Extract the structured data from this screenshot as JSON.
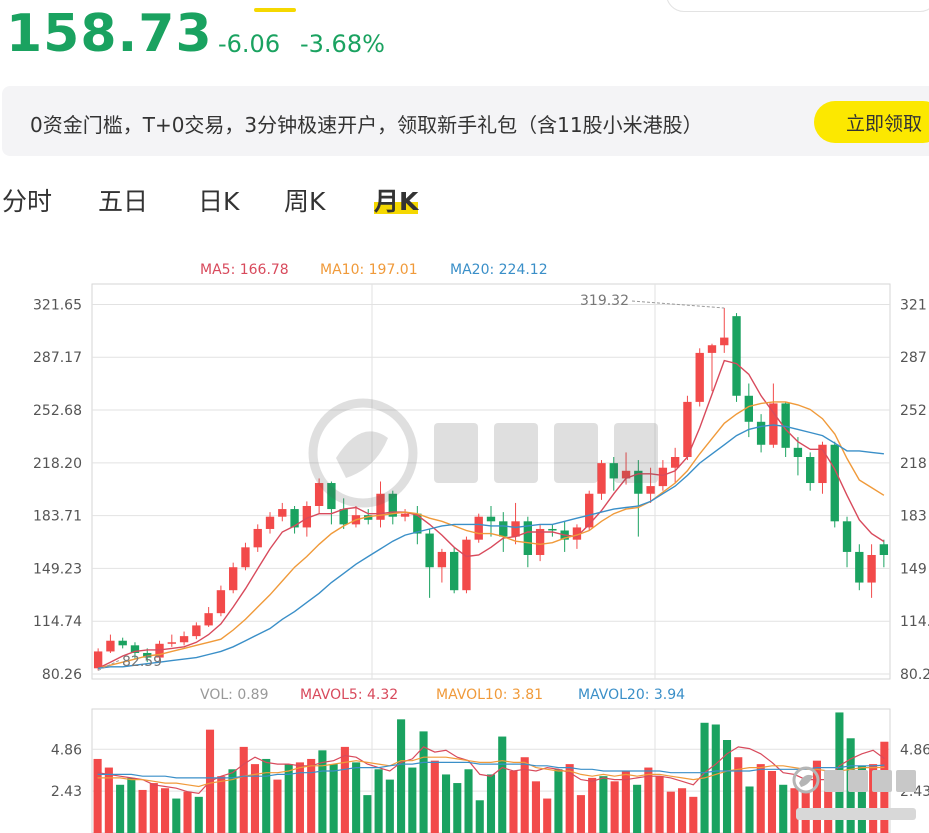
{
  "topnav": {
    "items": [],
    "search_placeholder": ""
  },
  "quote": {
    "price": "158.73",
    "change": "-6.06",
    "change_pct": "-3.68%"
  },
  "banner": {
    "text": "0资金门槛，T+0交易，3分钟极速开户，领取新手礼包（含11股小米港股）",
    "button": "立即领取"
  },
  "tabs": [
    {
      "label": "分时",
      "active": false
    },
    {
      "label": "五日",
      "active": false
    },
    {
      "label": "日K",
      "active": false
    },
    {
      "label": "周K",
      "active": false
    },
    {
      "label": "月K",
      "active": true
    }
  ],
  "chart_data": [
    {
      "type": "candlestick",
      "ylim": [
        77,
        335
      ],
      "y_ticks": [
        "321.65",
        "287.17",
        "252.68",
        "218.20",
        "183.71",
        "149.23",
        "114.74",
        "80.26"
      ],
      "y_ticks_right": [
        "321",
        "287",
        "252",
        "218",
        "183",
        "149",
        "114.",
        "80.2"
      ],
      "y_tick_values": [
        321.65,
        287.17,
        252.68,
        218.2,
        183.71,
        149.23,
        114.74,
        80.26
      ],
      "legend": [
        {
          "label": "MA5: 166.78",
          "color": "#d84a5c"
        },
        {
          "label": "MA10: 197.01",
          "color": "#f09a3a"
        },
        {
          "label": "MA20: 224.12",
          "color": "#3a8fc8"
        }
      ],
      "annotations": {
        "high": "319.32",
        "low": "82.59"
      },
      "colors": {
        "up": "#f24a4a",
        "down": "#1aa260",
        "ma5": "#d84a5c",
        "ma10": "#f09a3a",
        "ma20": "#3a8fc8"
      },
      "candles": [
        [
          84,
          95,
          82.59,
          97
        ],
        [
          95,
          102,
          94,
          106
        ],
        [
          102,
          99,
          97,
          104
        ],
        [
          99,
          94,
          90,
          101
        ],
        [
          94,
          91,
          88,
          97
        ],
        [
          91,
          100,
          89,
          102
        ],
        [
          100,
          101,
          98,
          106
        ],
        [
          101,
          105,
          99,
          108
        ],
        [
          105,
          112,
          103,
          114
        ],
        [
          112,
          120,
          111,
          124
        ],
        [
          120,
          135,
          118,
          138
        ],
        [
          135,
          150,
          133,
          153
        ],
        [
          150,
          163,
          148,
          166
        ],
        [
          163,
          175,
          160,
          178
        ],
        [
          175,
          183,
          172,
          186
        ],
        [
          183,
          188,
          180,
          192
        ],
        [
          188,
          176,
          172,
          190
        ],
        [
          176,
          190,
          170,
          193
        ],
        [
          190,
          205,
          185,
          208
        ],
        [
          205,
          188,
          178,
          206
        ],
        [
          188,
          178,
          175,
          195
        ],
        [
          178,
          184,
          176,
          190
        ],
        [
          184,
          181,
          178,
          188
        ],
        [
          181,
          198,
          176,
          206
        ],
        [
          198,
          183,
          178,
          200
        ],
        [
          183,
          185,
          180,
          188
        ],
        [
          185,
          172,
          165,
          190
        ],
        [
          172,
          150,
          130,
          175
        ],
        [
          150,
          160,
          140,
          162
        ],
        [
          160,
          135,
          133,
          163
        ],
        [
          135,
          168,
          133,
          170
        ],
        [
          168,
          183,
          166,
          185
        ],
        [
          183,
          180,
          170,
          190
        ],
        [
          180,
          170,
          160,
          186
        ],
        [
          170,
          180,
          165,
          192
        ],
        [
          180,
          158,
          150,
          183
        ],
        [
          158,
          175,
          154,
          178
        ],
        [
          175,
          174,
          170,
          178
        ],
        [
          174,
          168,
          160,
          180
        ],
        [
          168,
          176,
          162,
          178
        ],
        [
          176,
          198,
          174,
          200
        ],
        [
          198,
          218,
          194,
          220
        ],
        [
          218,
          208,
          200,
          222
        ],
        [
          208,
          213,
          204,
          225
        ],
        [
          213,
          198,
          170,
          220
        ],
        [
          198,
          203,
          192,
          215
        ],
        [
          203,
          215,
          200,
          220
        ],
        [
          215,
          222,
          205,
          228
        ],
        [
          222,
          258,
          220,
          262
        ],
        [
          258,
          290,
          255,
          293
        ],
        [
          290,
          295,
          265,
          296
        ],
        [
          295,
          300,
          290,
          319.32
        ],
        [
          314,
          262,
          258,
          316
        ],
        [
          262,
          245,
          235,
          270
        ],
        [
          245,
          230,
          225,
          250
        ],
        [
          230,
          257,
          228,
          270
        ],
        [
          257,
          228,
          222,
          258
        ],
        [
          228,
          222,
          210,
          235
        ],
        [
          222,
          205,
          200,
          225
        ],
        [
          205,
          230,
          198,
          232
        ],
        [
          230,
          180,
          176,
          232
        ],
        [
          180,
          160,
          150,
          183
        ],
        [
          160,
          140,
          135,
          165
        ],
        [
          140,
          158,
          130,
          165
        ],
        [
          165,
          158,
          150,
          168
        ]
      ],
      "series": [
        {
          "name": "MA5",
          "values": [
            84,
            88,
            92,
            95,
            96,
            96,
            97,
            98,
            101,
            106,
            113,
            124,
            136,
            149,
            162,
            173,
            177,
            182,
            185,
            185,
            188,
            189,
            185,
            185,
            186,
            186,
            184,
            178,
            171,
            163,
            157,
            158,
            163,
            169,
            170,
            173,
            173,
            173,
            171,
            170,
            178,
            187,
            198,
            208,
            211,
            211,
            210,
            213,
            222,
            241,
            263,
            285,
            283,
            276,
            262,
            251,
            240,
            232,
            227,
            227,
            214,
            197,
            181,
            172,
            166.78
          ]
        },
        {
          "name": "MA10",
          "values": [
            84,
            86,
            88,
            90,
            92,
            93,
            95,
            97,
            99,
            101,
            103,
            109,
            116,
            124,
            132,
            141,
            150,
            157,
            165,
            172,
            177,
            181,
            183,
            184,
            185,
            186,
            185,
            182,
            180,
            177,
            174,
            172,
            172,
            170,
            167,
            166,
            165,
            166,
            169,
            171,
            174,
            180,
            185,
            188,
            189,
            193,
            199,
            205,
            213,
            224,
            234,
            244,
            250,
            255,
            257,
            258,
            258,
            256,
            253,
            247,
            237,
            221,
            207,
            202,
            197.01
          ]
        },
        {
          "name": "MA20",
          "values": [
            84,
            85,
            85,
            86,
            87,
            88,
            89,
            90,
            91,
            93,
            95,
            98,
            102,
            106,
            110,
            116,
            121,
            127,
            133,
            140,
            146,
            152,
            157,
            162,
            167,
            171,
            173,
            175,
            177,
            178,
            178,
            178,
            177,
            177,
            176,
            177,
            178,
            178,
            180,
            182,
            184,
            186,
            188,
            189,
            190,
            193,
            198,
            203,
            210,
            218,
            224,
            230,
            236,
            240,
            242,
            243,
            242,
            240,
            238,
            236,
            231,
            226,
            226,
            225,
            224.12
          ]
        }
      ]
    },
    {
      "type": "bar",
      "ylim": [
        0,
        7.2
      ],
      "y_ticks": [
        "4.86",
        "2.43"
      ],
      "y_ticks_right": [
        "4.86",
        "2.43"
      ],
      "y_tick_values": [
        4.86,
        2.43
      ],
      "legend": [
        {
          "label": "VOL: 0.89",
          "color": "#999999"
        },
        {
          "label": "MAVOL5: 4.32",
          "color": "#d84a5c"
        },
        {
          "label": "MAVOL10: 3.81",
          "color": "#f09a3a"
        },
        {
          "label": "MAVOL20: 3.94",
          "color": "#3a8fc8"
        }
      ],
      "values": [
        4.3,
        3.8,
        2.8,
        3.2,
        2.5,
        2.9,
        2.6,
        2.0,
        2.4,
        2.1,
        6.0,
        3.3,
        3.7,
        5.0,
        4.0,
        4.3,
        3.1,
        4.0,
        4.1,
        4.3,
        4.8,
        4.0,
        5.0,
        4.1,
        2.2,
        3.7,
        3.1,
        6.6,
        3.8,
        5.9,
        4.2,
        3.4,
        2.9,
        3.7,
        1.9,
        3.4,
        5.6,
        3.6,
        4.4,
        3.0,
        2.0,
        3.7,
        4.0,
        2.2,
        3.2,
        3.3,
        3.0,
        3.6,
        2.8,
        3.8,
        3.3,
        2.4,
        2.6,
        2.1,
        6.4,
        6.3,
        5.4,
        4.4,
        2.7,
        4.0,
        3.6,
        2.8,
        2.6,
        2.4,
        4.2,
        3.6,
        7.0,
        5.5,
        3.9,
        4.0,
        5.3
      ],
      "up": [
        1,
        1,
        0,
        0,
        1,
        1,
        1,
        0,
        1,
        0,
        1,
        1,
        0,
        1,
        1,
        0,
        1,
        0,
        1,
        1,
        0,
        0,
        1,
        0,
        0,
        0,
        0,
        0,
        0,
        0,
        1,
        0,
        0,
        0,
        0,
        0,
        0,
        1,
        1,
        1,
        1,
        0,
        1,
        1,
        1,
        0,
        1,
        1,
        0,
        1,
        1,
        1,
        1,
        1,
        0,
        0,
        0,
        1,
        0,
        1,
        1,
        0,
        1,
        1,
        1,
        1,
        0,
        0,
        0,
        1,
        1
      ],
      "series": [
        {
          "name": "MAVOL5",
          "values": [
            3.5,
            3.4,
            3.3,
            3.2,
            3.1,
            2.8,
            2.7,
            2.6,
            2.4,
            2.3,
            3.0,
            3.3,
            3.5,
            4.0,
            4.4,
            4.1,
            4.0,
            4.0,
            3.9,
            3.9,
            4.1,
            4.2,
            4.5,
            4.4,
            4.0,
            3.8,
            3.6,
            4.1,
            4.3,
            5.0,
            4.7,
            4.8,
            4.4,
            4.2,
            3.4,
            3.3,
            3.8,
            3.6,
            3.7,
            3.6,
            3.8,
            3.7,
            3.5,
            3.1,
            3.0,
            3.2,
            3.1,
            3.1,
            3.2,
            3.3,
            3.3,
            3.2,
            3.0,
            2.8,
            3.5,
            4.0,
            4.6,
            5.0,
            4.9,
            4.6,
            4.1,
            3.5,
            3.4,
            3.1,
            3.1,
            3.1,
            3.9,
            4.3,
            4.6,
            4.8,
            4.32
          ]
        },
        {
          "name": "MAVOL10",
          "values": [
            3.2,
            3.2,
            3.2,
            3.1,
            3.1,
            3.0,
            2.9,
            2.9,
            2.8,
            2.7,
            2.9,
            3.0,
            3.1,
            3.3,
            3.4,
            3.5,
            3.5,
            3.6,
            3.8,
            3.9,
            3.9,
            4.0,
            4.1,
            4.2,
            4.1,
            4.0,
            3.9,
            4.2,
            4.2,
            4.4,
            4.4,
            4.4,
            4.3,
            4.2,
            4.1,
            4.1,
            4.2,
            4.1,
            4.1,
            3.8,
            3.7,
            3.6,
            3.6,
            3.4,
            3.3,
            3.4,
            3.3,
            3.4,
            3.3,
            3.4,
            3.4,
            3.3,
            3.2,
            3.1,
            3.2,
            3.4,
            3.6,
            3.7,
            3.8,
            3.8,
            3.9,
            3.9,
            3.8,
            3.7,
            3.7,
            3.6,
            3.6,
            3.7,
            3.8,
            3.8,
            3.81
          ]
        },
        {
          "name": "MAVOL20",
          "values": [
            3.4,
            3.4,
            3.4,
            3.4,
            3.3,
            3.3,
            3.3,
            3.2,
            3.2,
            3.2,
            3.2,
            3.2,
            3.2,
            3.3,
            3.3,
            3.3,
            3.4,
            3.4,
            3.5,
            3.5,
            3.6,
            3.6,
            3.7,
            3.8,
            3.8,
            3.8,
            3.9,
            4.0,
            4.0,
            4.1,
            4.1,
            4.1,
            4.1,
            4.1,
            4.0,
            4.0,
            4.0,
            4.0,
            4.0,
            3.9,
            3.9,
            3.8,
            3.8,
            3.7,
            3.7,
            3.6,
            3.6,
            3.6,
            3.6,
            3.6,
            3.6,
            3.5,
            3.5,
            3.5,
            3.5,
            3.6,
            3.6,
            3.6,
            3.6,
            3.7,
            3.7,
            3.7,
            3.7,
            3.7,
            3.8,
            3.8,
            3.8,
            3.9,
            3.9,
            3.9,
            3.94
          ]
        }
      ]
    }
  ]
}
